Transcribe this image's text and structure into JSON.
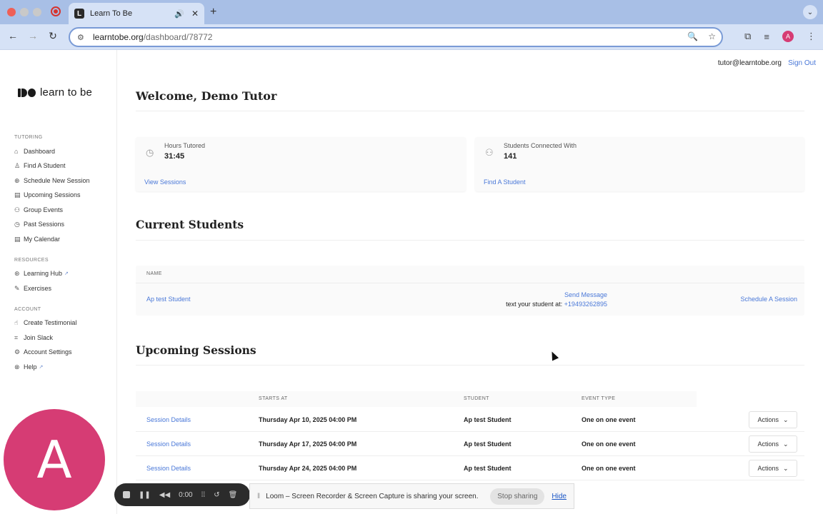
{
  "browser": {
    "tab_title": "Learn To Be",
    "favicon_letter": "L",
    "url_host": "learntobe.org",
    "url_path": "/dashboard/78772",
    "profile_initial": "A"
  },
  "header": {
    "user_email": "tutor@learntobe.org",
    "sign_out": "Sign Out"
  },
  "sidebar": {
    "logo_text": "learn to be",
    "sections": [
      {
        "title": "TUTORING",
        "items": [
          {
            "label": "Dashboard",
            "icon": "home-icon"
          },
          {
            "label": "Find A Student",
            "icon": "user-search-icon"
          },
          {
            "label": "Schedule New Session",
            "icon": "plus-circle-icon"
          },
          {
            "label": "Upcoming Sessions",
            "icon": "calendar-icon"
          },
          {
            "label": "Group Events",
            "icon": "group-icon"
          },
          {
            "label": "Past Sessions",
            "icon": "clock-icon"
          },
          {
            "label": "My Calendar",
            "icon": "calendar-icon"
          }
        ]
      },
      {
        "title": "RESOURCES",
        "items": [
          {
            "label": "Learning Hub",
            "icon": "hub-icon",
            "external": true
          },
          {
            "label": "Exercises",
            "icon": "exercise-icon"
          }
        ]
      },
      {
        "title": "ACCOUNT",
        "items": [
          {
            "label": "Create Testimonial",
            "icon": "thumbs-up-icon"
          },
          {
            "label": "Join Slack",
            "icon": "slack-icon"
          },
          {
            "label": "Account Settings",
            "icon": "gear-icon"
          },
          {
            "label": "Help",
            "icon": "help-icon",
            "external": true
          }
        ]
      }
    ]
  },
  "main": {
    "welcome": "Welcome, Demo Tutor",
    "stats": [
      {
        "label": "Hours Tutored",
        "value": "31:45",
        "link": "View Sessions",
        "icon": "clock-icon"
      },
      {
        "label": "Students Connected With",
        "value": "141",
        "link": "Find A Student",
        "icon": "users-icon"
      }
    ],
    "current_students": {
      "title": "Current Students",
      "column_name": "NAME",
      "rows": [
        {
          "name": "Ap test Student",
          "send_message": "Send Message",
          "text_prefix": "text your student at: ",
          "phone": "+19493262895",
          "schedule": "Schedule A Session"
        }
      ]
    },
    "upcoming_sessions": {
      "title": "Upcoming Sessions",
      "columns": [
        "STARTS AT",
        "STUDENT",
        "EVENT TYPE"
      ],
      "rows": [
        {
          "link": "Session Details",
          "starts_at": "Thursday Apr 10, 2025 04:00 PM",
          "student": "Ap test Student",
          "event_type": "One on one event",
          "actions": "Actions"
        },
        {
          "link": "Session Details",
          "starts_at": "Thursday Apr 17, 2025 04:00 PM",
          "student": "Ap test Student",
          "event_type": "One on one event",
          "actions": "Actions"
        },
        {
          "link": "Session Details",
          "starts_at": "Thursday Apr 24, 2025 04:00 PM",
          "student": "Ap test Student",
          "event_type": "One on one event",
          "actions": "Actions"
        }
      ]
    }
  },
  "overlays": {
    "avatar_initial": "A",
    "avatar_color": "#d63c74",
    "loom_timer": "0:00",
    "share_message": "Loom – Screen Recorder & Screen Capture is sharing your screen.",
    "stop_sharing": "Stop sharing",
    "hide": "Hide"
  }
}
